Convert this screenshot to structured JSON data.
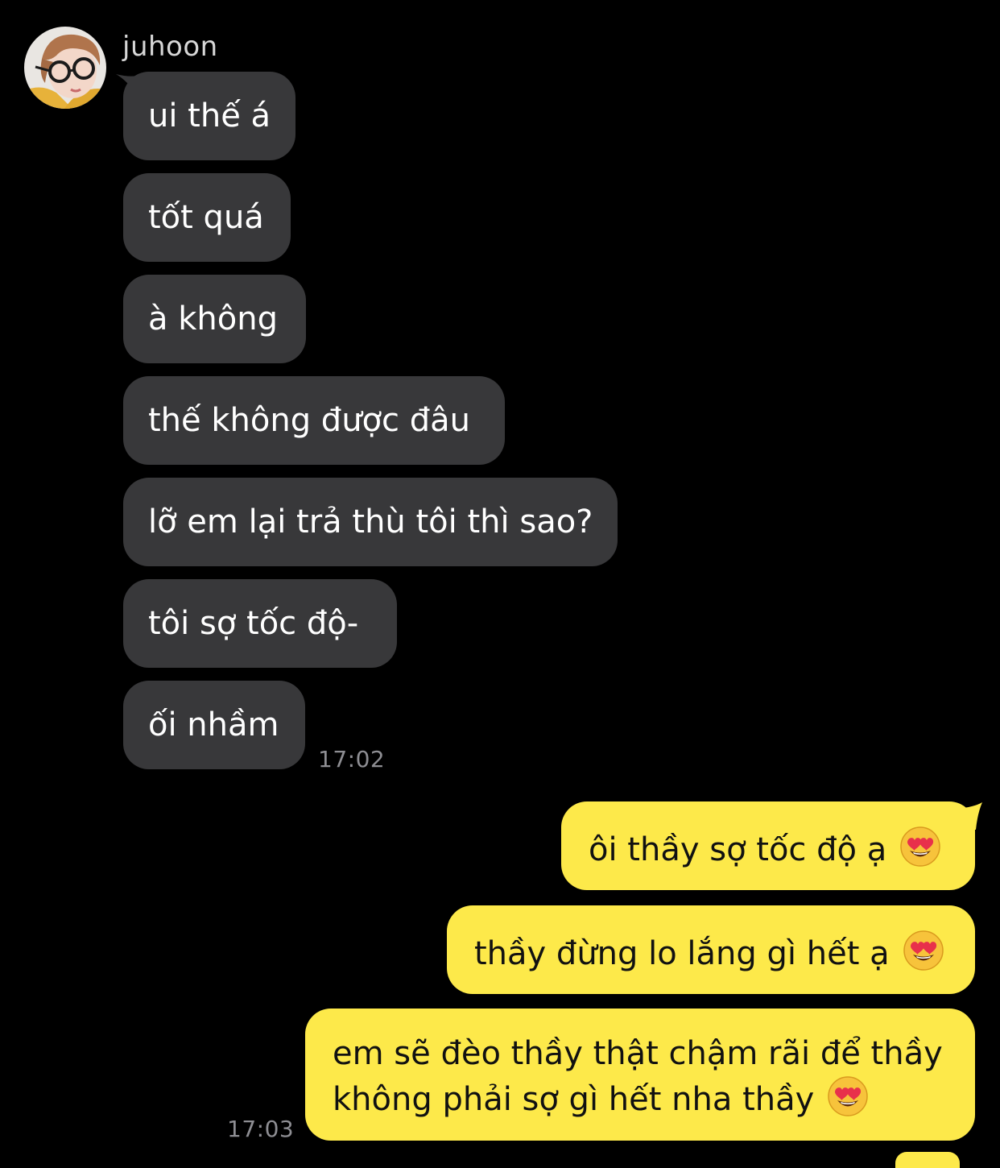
{
  "chat": {
    "sender_name": "juhoon",
    "incoming": [
      {
        "text": "ui thế á"
      },
      {
        "text": "tốt quá"
      },
      {
        "text": "à không"
      },
      {
        "text": "thế không được đâu"
      },
      {
        "text": "lỡ em lại trả thù tôi thì sao?"
      },
      {
        "text": "tôi sợ tốc độ-"
      },
      {
        "text": "ối nhầm"
      }
    ],
    "incoming_time": "17:02",
    "outgoing": [
      {
        "text": "ôi thầy sợ tốc độ ạ",
        "emoji": "heart-eyes-emoji"
      },
      {
        "text": "thầy đừng lo lắng gì hết ạ",
        "emoji": "heart-eyes-emoji"
      },
      {
        "line1": "em sẽ đèo thầy thật chậm rãi để thầy",
        "line2": "không phải sợ gì hết nha thầy",
        "emoji": "heart-eyes-emoji"
      }
    ],
    "outgoing_time": "17:03"
  },
  "colors": {
    "background": "#000000",
    "incoming_bubble": "#38383a",
    "outgoing_bubble": "#fde94a",
    "timestamp": "#8e8e93"
  }
}
